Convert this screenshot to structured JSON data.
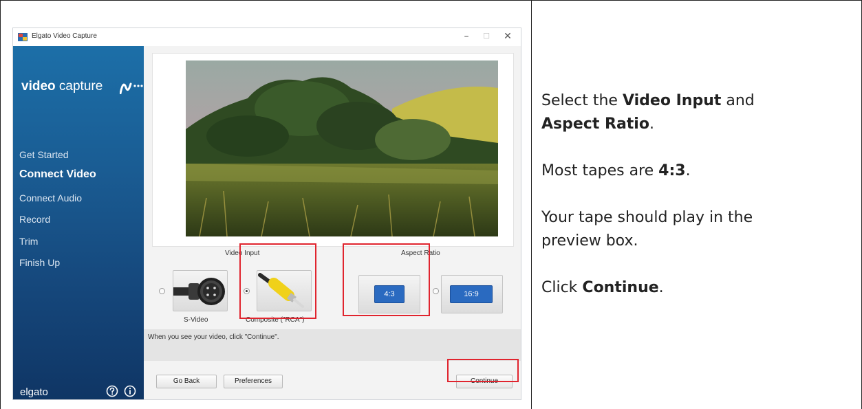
{
  "window": {
    "title": "Elgato Video Capture",
    "controls": {
      "minimize": "–",
      "maximize": "☐",
      "close": "✕"
    }
  },
  "sidebar": {
    "logo": {
      "bold": "video",
      "light": "capture"
    },
    "items": [
      {
        "label": "Get Started",
        "active": false
      },
      {
        "label": "Connect Video",
        "active": true
      },
      {
        "label": "Connect Audio",
        "active": false
      },
      {
        "label": "Record",
        "active": false
      },
      {
        "label": "Trim",
        "active": false
      },
      {
        "label": "Finish Up",
        "active": false
      }
    ],
    "brand": "elgato",
    "icons": [
      "help-icon",
      "info-icon"
    ]
  },
  "content": {
    "video_input_label": "Video Input",
    "aspect_ratio_label": "Aspect Ratio",
    "inputs": [
      {
        "label": "S-Video",
        "selected": false
      },
      {
        "label": "Composite (\"RCA\")",
        "selected": true
      }
    ],
    "aspects": [
      {
        "label": "4:3",
        "selected": true
      },
      {
        "label": "16:9",
        "selected": false
      }
    ],
    "hint": "When you see your video, click \"Continue\".",
    "buttons": {
      "back": "Go Back",
      "prefs": "Preferences",
      "continue": "Continue"
    }
  },
  "colors": {
    "sidebar_top": "#1c6fa8",
    "sidebar_bottom": "#0f3564",
    "highlight": "#e0242e",
    "aspect_chip": "#2a6ac0"
  },
  "instructions": {
    "l1_pre": "Select the ",
    "l1_b1": "Video Input",
    "l1_mid": " and",
    "l2_b": "Aspect Ratio",
    "l2_post": ".",
    "l3_pre": "Most tapes are ",
    "l3_b": "4:3",
    "l3_post": ".",
    "l4": "Your tape should play in the",
    "l5": "preview box.",
    "l6_pre": "Click ",
    "l6_b": "Continue",
    "l6_post": "."
  }
}
